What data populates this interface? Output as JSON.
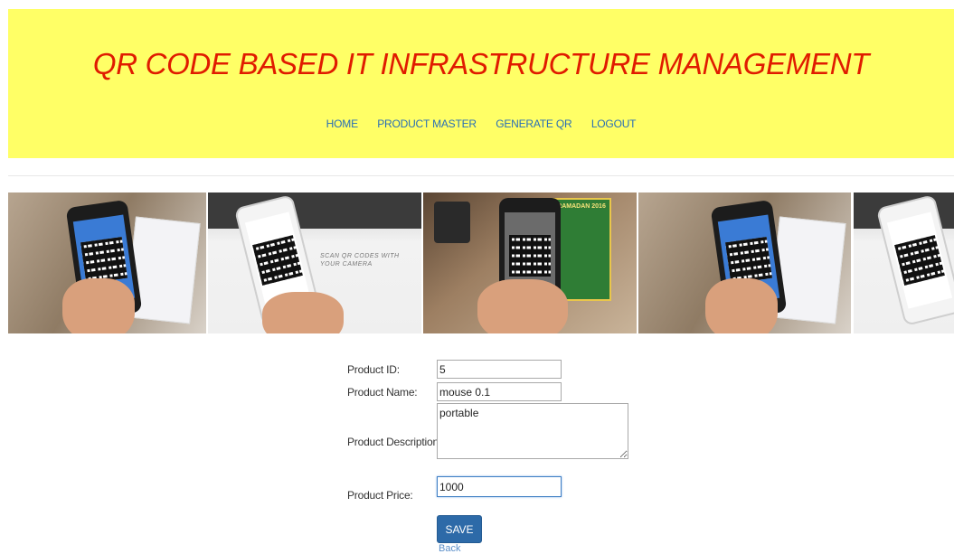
{
  "header": {
    "title": "QR CODE BASED IT INFRASTRUCTURE MANAGEMENT",
    "nav": [
      "HOME",
      "PRODUCT MASTER",
      "GENERATE QR",
      "LOGOUT"
    ]
  },
  "banner": {
    "caption": "SCAN QR CODES WITH YOUR CAMERA",
    "sign_text": "RAMADAN 2016"
  },
  "form": {
    "product_id": {
      "label": "Product ID:",
      "value": "5"
    },
    "product_name": {
      "label": "Product Name:",
      "value": "mouse 0.1"
    },
    "product_description": {
      "label": "Product Description:",
      "value": "portable"
    },
    "product_price": {
      "label": "Product Price:",
      "value": "1000"
    },
    "save_label": "SAVE",
    "back_label": "Back"
  },
  "colors": {
    "header_bg": "#ffff66",
    "title": "#e01b00",
    "nav_link": "#2a6fb5",
    "save_button": "#2d6aa8"
  }
}
